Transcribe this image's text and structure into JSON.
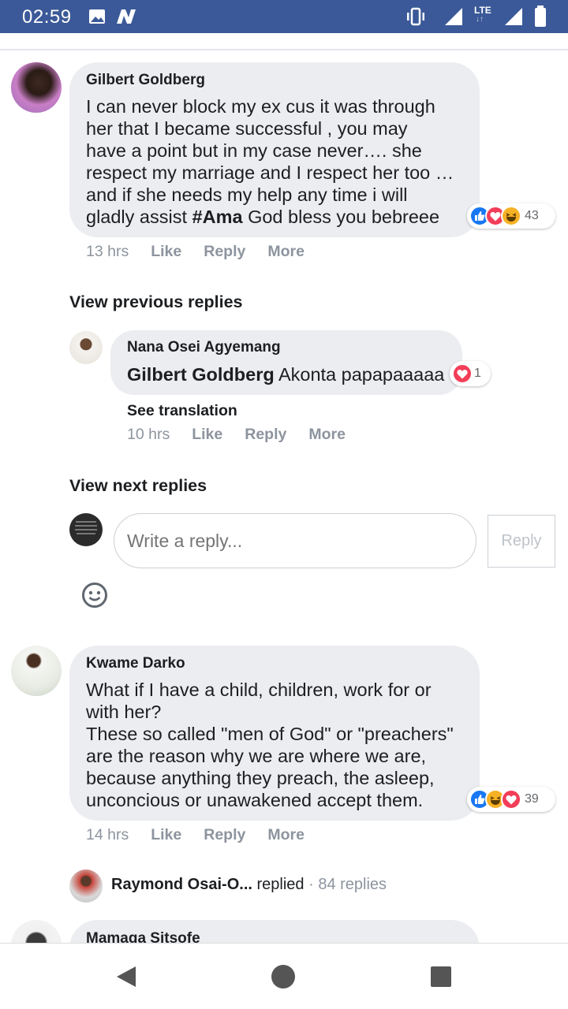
{
  "status_bar": {
    "time": "02:59",
    "network": "LTE"
  },
  "comments": [
    {
      "author": "Gilbert Goldberg",
      "text_before": "I can never block my ex cus it was through\nher that I became successful , you may\nhave a point but in my case never…. she\nrespect my marriage and I respect her too …\nand if she needs my help any time i will\ngladly assist ",
      "hashtag": "#Ama",
      "text_after": " God bless you bebreee",
      "reaction_count": "43",
      "time": "13 hrs",
      "like_label": "Like",
      "reply_label": "Reply",
      "more_label": "More"
    },
    {
      "author": "Kwame Darko",
      "text": "What if I have a child, children, work for or\nwith her?\nThese so called \"men of God\" or \"preachers\"\nare the reason why we are where we are,\nbecause anything they preach, the asleep,\nunconcious or unawakened accept them.",
      "reaction_count": "39",
      "time": "14 hrs",
      "like_label": "Like",
      "reply_label": "Reply",
      "more_label": "More"
    }
  ],
  "view_previous": "View previous replies",
  "reply": {
    "author": "Nana Osei Agyemang",
    "mention": "Gilbert Goldberg",
    "text": " Akonta papapaaaaa",
    "reaction_count": "1",
    "see_translation": "See translation",
    "time": "10 hrs",
    "like_label": "Like",
    "reply_label": "Reply",
    "more_label": "More"
  },
  "view_next": "View next replies",
  "composer": {
    "placeholder": "Write a reply...",
    "button": "Reply"
  },
  "replies_summary": {
    "name": "Raymond Osai-O...",
    "action": " replied",
    "count": " · 84 replies"
  },
  "next_comment": {
    "author": "Mamaga Sitsofe"
  },
  "colors": {
    "status_bar": "#3b5998",
    "bubble": "#ebedf0",
    "like": "#1877f2",
    "love": "#f33e58",
    "haha": "#f7b125"
  }
}
